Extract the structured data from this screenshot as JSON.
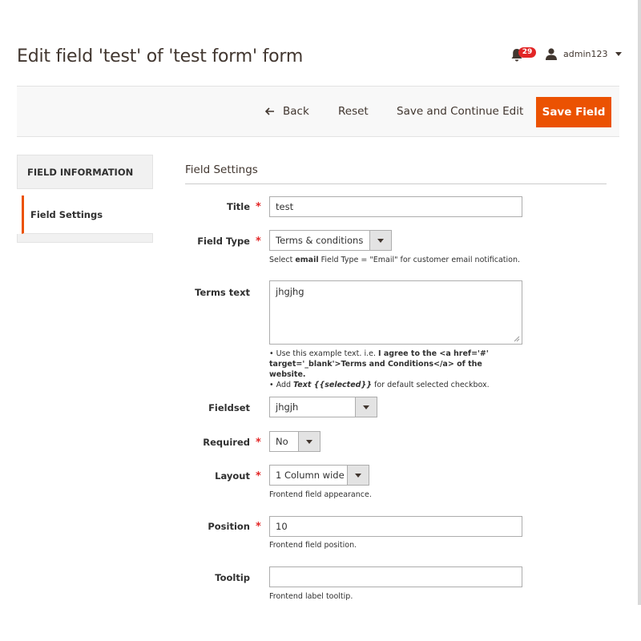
{
  "page": {
    "title": "Edit field 'test' of 'test form' form"
  },
  "header": {
    "notifications_count": "29",
    "user_name": "admin123"
  },
  "actions": {
    "back_label": "Back",
    "reset_label": "Reset",
    "save_continue_label": "Save and Continue Edit",
    "save_label": "Save Field"
  },
  "sidebar": {
    "heading": "FIELD INFORMATION",
    "items": [
      {
        "label": "Field Settings",
        "active": true
      }
    ]
  },
  "section": {
    "title": "Field Settings"
  },
  "form": {
    "title": {
      "label": "Title",
      "value": "test",
      "required": true
    },
    "field_type": {
      "label": "Field Type",
      "value": "Terms & conditions",
      "required": true,
      "note_pre": "Select ",
      "note_bold": "email",
      "note_post": " Field Type = \"Email\" for customer email notification."
    },
    "terms_text": {
      "label": "Terms text",
      "value": "jhgjhg",
      "note1_pre": "• Use this example text. i.e. ",
      "note1_bold": "I agree to the <a href='#'",
      "note1_line2_bold": "target='_blank'>Terms and Conditions</a> of the website.",
      "note2_pre": "• Add ",
      "note2_bold": "Text {{selected}}",
      "note2_post": " for default selected checkbox."
    },
    "fieldset": {
      "label": "Fieldset",
      "value": "jhgjh",
      "required": false
    },
    "required": {
      "label": "Required",
      "value": "No",
      "required": true
    },
    "layout": {
      "label": "Layout",
      "value": "1 Column wide",
      "required": true,
      "note": "Frontend field appearance."
    },
    "position": {
      "label": "Position",
      "value": "10",
      "required": true,
      "note": "Frontend field position."
    },
    "tooltip": {
      "label": "Tooltip",
      "value": "",
      "required": false,
      "note": "Frontend label tooltip."
    }
  },
  "colors": {
    "accent": "#eb5202",
    "required": "#e22626",
    "badge": "#e22626"
  }
}
